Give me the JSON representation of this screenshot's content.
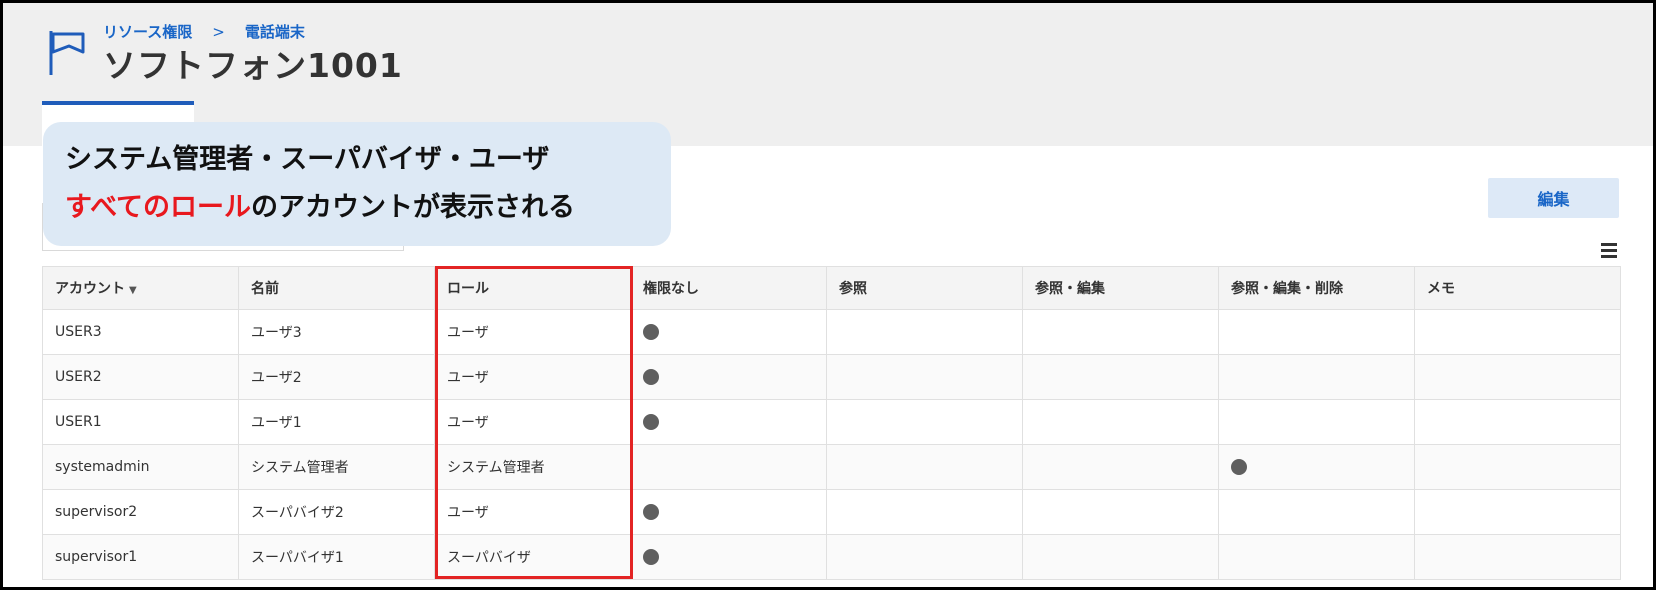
{
  "header": {
    "breadcrumb": [
      "リソース権限",
      ">",
      "電話端末"
    ],
    "title": "ソフトフォン1001"
  },
  "callout": {
    "line1": "システム管理者・スーパバイザ・ユーザ",
    "line2_accent": "すべてのロール",
    "line2_rest": "のアカウントが表示される"
  },
  "toolbar": {
    "edit_label": "編集"
  },
  "table": {
    "columns": [
      "アカウント",
      "名前",
      "ロール",
      "権限なし",
      "参照",
      "参照・編集",
      "参照・編集・削除",
      "メモ"
    ],
    "rows": [
      {
        "account": "USER3",
        "name": "ユーザ3",
        "role": "ユーザ",
        "permission_level": "権限なし",
        "memo": ""
      },
      {
        "account": "USER2",
        "name": "ユーザ2",
        "role": "ユーザ",
        "permission_level": "権限なし",
        "memo": ""
      },
      {
        "account": "USER1",
        "name": "ユーザ1",
        "role": "ユーザ",
        "permission_level": "権限なし",
        "memo": ""
      },
      {
        "account": "systemadmin",
        "name": "システム管理者",
        "role": "システム管理者",
        "permission_level": "参照・編集・削除",
        "memo": ""
      },
      {
        "account": "supervisor2",
        "name": "スーパバイザ2",
        "role": "ユーザ",
        "permission_level": "権限なし",
        "memo": ""
      },
      {
        "account": "supervisor1",
        "name": "スーパバイザ1",
        "role": "スーパバイザ",
        "permission_level": "権限なし",
        "memo": ""
      }
    ]
  },
  "colors": {
    "accent_blue": "#1a66c7",
    "highlight_red": "#e32424",
    "callout_bg": "#dde9f5",
    "dot": "#5f5f5f"
  }
}
